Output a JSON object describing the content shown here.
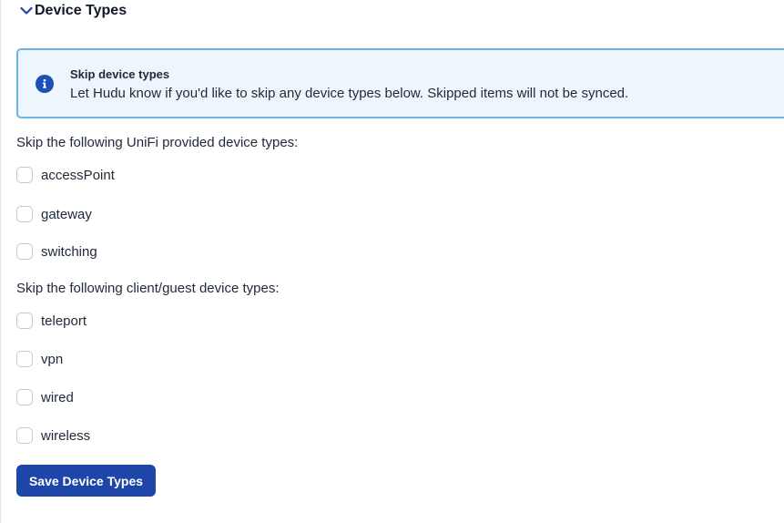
{
  "section": {
    "title": "Device Types",
    "expanded_icon": "chevron-down-icon"
  },
  "info": {
    "icon": "info-icon",
    "title": "Skip device types",
    "text": "Let Hudu know if you'd like to skip any device types below. Skipped items will not be synced."
  },
  "unifi_group": {
    "label": "Skip the following UniFi provided device types:",
    "items": [
      {
        "label": "accessPoint",
        "checked": false
      },
      {
        "label": "gateway",
        "checked": false
      },
      {
        "label": "switching",
        "checked": false
      }
    ]
  },
  "client_group": {
    "label": "Skip the following client/guest device types:",
    "items": [
      {
        "label": "teleport",
        "checked": false
      },
      {
        "label": "vpn",
        "checked": false
      },
      {
        "label": "wired",
        "checked": false
      },
      {
        "label": "wireless",
        "checked": false
      }
    ]
  },
  "save_button": {
    "label": "Save Device Types"
  },
  "colors": {
    "accent": "#1e45a8",
    "info_border": "#6cb4e6",
    "info_background": "#eef6fd"
  }
}
